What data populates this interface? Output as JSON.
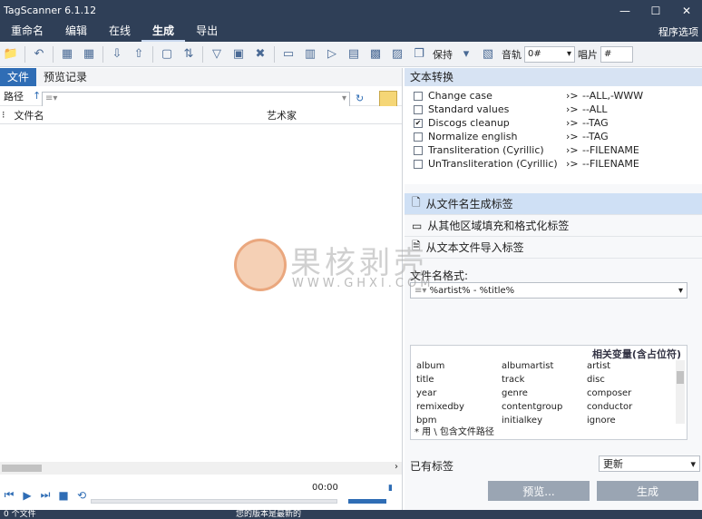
{
  "window": {
    "title": "TagScanner 6.1.12"
  },
  "menu": {
    "items": [
      "重命名",
      "编辑",
      "在线",
      "生成",
      "导出"
    ],
    "active_index": 3,
    "right_label": "程序选项"
  },
  "toolbar": {
    "save_label": "保持",
    "track_label": "音轨",
    "track_value": "0#",
    "disc_label": "唱片",
    "disc_value": "#"
  },
  "left": {
    "tabs": [
      "文件",
      "预览记录"
    ],
    "path_label": "路径",
    "path_placeholder": "",
    "columns": [
      "文件名",
      "艺术家"
    ],
    "time": "00:00",
    "status_left": "0 个文件",
    "status_right": "您的版本是最新的"
  },
  "text_transform": {
    "header": "文本转换",
    "rows": [
      {
        "name": "Change case",
        "checked": false,
        "value": "--ALL,-WWW"
      },
      {
        "name": "Standard values",
        "checked": false,
        "value": "--ALL"
      },
      {
        "name": "Discogs cleanup",
        "checked": true,
        "value": "--TAG"
      },
      {
        "name": "Normalize english",
        "checked": false,
        "value": "--TAG"
      },
      {
        "name": "Transliteration (Cyrillic)",
        "checked": false,
        "value": "--FILENAME"
      },
      {
        "name": "UnTransliteration (Cyrillic)",
        "checked": false,
        "value": "--FILENAME"
      }
    ]
  },
  "panels": [
    {
      "label": "从文件名生成标签",
      "active": true
    },
    {
      "label": "从其他区域填充和格式化标签",
      "active": false
    },
    {
      "label": "从文本文件导入标签",
      "active": false
    }
  ],
  "format": {
    "label": "文件名格式:",
    "value": "%artist% - %title%"
  },
  "variables": {
    "header": "相关变量(含占位符)",
    "items": [
      "album",
      "albumartist",
      "artist",
      "title",
      "track",
      "disc",
      "year",
      "genre",
      "composer",
      "remixedby",
      "contentgroup",
      "conductor",
      "bpm",
      "initialkey",
      "ignore"
    ],
    "footnote": "* 用 \\ 包含文件路径"
  },
  "bottom": {
    "existing_label": "已有标签",
    "update_value": "更新",
    "preview_button": "预览...",
    "generate_button": "生成"
  },
  "watermark": {
    "text": "果核剥壳",
    "url": "WWW.GHXI.COM"
  },
  "colors": {
    "titlebar": "#2f3f57",
    "accent": "#2f6db5",
    "section": "#d7e3f3"
  }
}
